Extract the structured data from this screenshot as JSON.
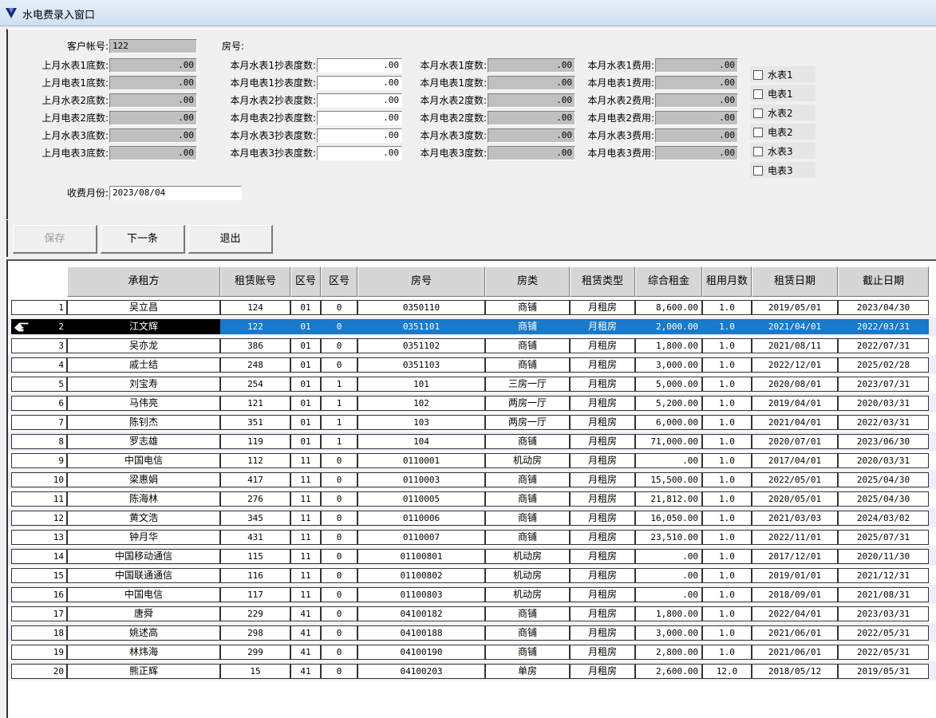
{
  "window": {
    "title": "水电费录入窗口"
  },
  "form": {
    "account_label": "客户帐号:",
    "account_value": "122",
    "room_label": "房号:",
    "room_value": "",
    "month_label": "收费月份:",
    "month_value": "2023/08/04",
    "meter_rows": [
      {
        "prev_label": "上月水表1底数:",
        "prev_value": ".00",
        "reading_label": "本月水表1抄表度数:",
        "reading_value": ".00",
        "usage_label": "本月水表1度数:",
        "usage_value": ".00",
        "fee_label": "本月水表1费用:",
        "fee_value": ".00",
        "check_label": "水表1",
        "checked": false
      },
      {
        "prev_label": "上月电表1底数:",
        "prev_value": ".00",
        "reading_label": "本月电表1抄表度数:",
        "reading_value": ".00",
        "usage_label": "本月电表1度数:",
        "usage_value": ".00",
        "fee_label": "本月电表1费用:",
        "fee_value": ".00",
        "check_label": "电表1",
        "checked": false
      },
      {
        "prev_label": "上月水表2底数:",
        "prev_value": ".00",
        "reading_label": "本月水表2抄表度数:",
        "reading_value": ".00",
        "usage_label": "本月水表2度数:",
        "usage_value": ".00",
        "fee_label": "本月水表2费用:",
        "fee_value": ".00",
        "check_label": "水表2",
        "checked": false
      },
      {
        "prev_label": "上月电表2底数:",
        "prev_value": ".00",
        "reading_label": "本月电表2抄表度数:",
        "reading_value": ".00",
        "usage_label": "本月电表2度数:",
        "usage_value": ".00",
        "fee_label": "本月电表2费用:",
        "fee_value": ".00",
        "check_label": "电表2",
        "checked": false
      },
      {
        "prev_label": "上月水表3底数:",
        "prev_value": ".00",
        "reading_label": "本月水表3抄表度数:",
        "reading_value": ".00",
        "usage_label": "本月水表3度数:",
        "usage_value": ".00",
        "fee_label": "本月水表3费用:",
        "fee_value": ".00",
        "check_label": "水表3",
        "checked": false
      },
      {
        "prev_label": "上月电表3底数:",
        "prev_value": ".00",
        "reading_label": "本月电表3抄表度数:",
        "reading_value": ".00",
        "usage_label": "本月电表3度数:",
        "usage_value": ".00",
        "fee_label": "本月电表3费用:",
        "fee_value": ".00",
        "check_label": "电表3",
        "checked": false
      }
    ]
  },
  "toolbar": {
    "save_label": "保存",
    "next_label": "下一条",
    "exit_label": "退出"
  },
  "grid": {
    "headers": [
      "承租方",
      "租赁账号",
      "区号",
      "区号",
      "房号",
      "房类",
      "租赁类型",
      "综合租金",
      "租用月数",
      "租赁日期",
      "截止日期"
    ],
    "selected_index": 1,
    "rows": [
      {
        "no": "1",
        "tenant": "吴立昌",
        "acct": "124",
        "zone1": "01",
        "zone2": "0",
        "room": "0350110",
        "type": "商铺",
        "lease": "月租房",
        "rent": "8,600.00",
        "months": "1.0",
        "start": "2019/05/01",
        "end": "2023/04/30"
      },
      {
        "no": "2",
        "tenant": "江文辉",
        "acct": "122",
        "zone1": "01",
        "zone2": "0",
        "room": "0351101",
        "type": "商铺",
        "lease": "月租房",
        "rent": "2,000.00",
        "months": "1.0",
        "start": "2021/04/01",
        "end": "2022/03/31"
      },
      {
        "no": "3",
        "tenant": "吴亦龙",
        "acct": "386",
        "zone1": "01",
        "zone2": "0",
        "room": "0351102",
        "type": "商铺",
        "lease": "月租房",
        "rent": "1,800.00",
        "months": "1.0",
        "start": "2021/08/11",
        "end": "2022/07/31"
      },
      {
        "no": "4",
        "tenant": "戚士结",
        "acct": "248",
        "zone1": "01",
        "zone2": "0",
        "room": "0351103",
        "type": "商铺",
        "lease": "月租房",
        "rent": "3,000.00",
        "months": "1.0",
        "start": "2022/12/01",
        "end": "2025/02/28"
      },
      {
        "no": "5",
        "tenant": "刘宝寿",
        "acct": "254",
        "zone1": "01",
        "zone2": "1",
        "room": "101",
        "type": "三房一厅",
        "lease": "月租房",
        "rent": "5,000.00",
        "months": "1.0",
        "start": "2020/08/01",
        "end": "2023/07/31"
      },
      {
        "no": "6",
        "tenant": "马伟亮",
        "acct": "121",
        "zone1": "01",
        "zone2": "1",
        "room": "102",
        "type": "两房一厅",
        "lease": "月租房",
        "rent": "5,200.00",
        "months": "1.0",
        "start": "2019/04/01",
        "end": "2020/03/31"
      },
      {
        "no": "7",
        "tenant": "陈钊杰",
        "acct": "351",
        "zone1": "01",
        "zone2": "1",
        "room": "103",
        "type": "两房一厅",
        "lease": "月租房",
        "rent": "6,000.00",
        "months": "1.0",
        "start": "2021/04/01",
        "end": "2022/03/31"
      },
      {
        "no": "8",
        "tenant": "罗志雄",
        "acct": "119",
        "zone1": "01",
        "zone2": "1",
        "room": "104",
        "type": "商铺",
        "lease": "月租房",
        "rent": "71,000.00",
        "months": "1.0",
        "start": "2020/07/01",
        "end": "2023/06/30"
      },
      {
        "no": "9",
        "tenant": "中国电信",
        "acct": "112",
        "zone1": "11",
        "zone2": "0",
        "room": "0110001",
        "type": "机动房",
        "lease": "月租房",
        "rent": ".00",
        "months": "1.0",
        "start": "2017/04/01",
        "end": "2020/03/31"
      },
      {
        "no": "10",
        "tenant": "梁惠娟",
        "acct": "417",
        "zone1": "11",
        "zone2": "0",
        "room": "0110003",
        "type": "商铺",
        "lease": "月租房",
        "rent": "15,500.00",
        "months": "1.0",
        "start": "2022/05/01",
        "end": "2025/04/30"
      },
      {
        "no": "11",
        "tenant": "陈海林",
        "acct": "276",
        "zone1": "11",
        "zone2": "0",
        "room": "0110005",
        "type": "商铺",
        "lease": "月租房",
        "rent": "21,812.00",
        "months": "1.0",
        "start": "2020/05/01",
        "end": "2025/04/30"
      },
      {
        "no": "12",
        "tenant": "黄文浩",
        "acct": "345",
        "zone1": "11",
        "zone2": "0",
        "room": "0110006",
        "type": "商铺",
        "lease": "月租房",
        "rent": "16,050.00",
        "months": "1.0",
        "start": "2021/03/03",
        "end": "2024/03/02"
      },
      {
        "no": "13",
        "tenant": "钟月华",
        "acct": "431",
        "zone1": "11",
        "zone2": "0",
        "room": "0110007",
        "type": "商铺",
        "lease": "月租房",
        "rent": "23,510.00",
        "months": "1.0",
        "start": "2022/11/01",
        "end": "2025/07/31"
      },
      {
        "no": "14",
        "tenant": "中国移动通信",
        "acct": "115",
        "zone1": "11",
        "zone2": "0",
        "room": "01100801",
        "type": "机动房",
        "lease": "月租房",
        "rent": ".00",
        "months": "1.0",
        "start": "2017/12/01",
        "end": "2020/11/30"
      },
      {
        "no": "15",
        "tenant": "中国联通通信",
        "acct": "116",
        "zone1": "11",
        "zone2": "0",
        "room": "01100802",
        "type": "机动房",
        "lease": "月租房",
        "rent": ".00",
        "months": "1.0",
        "start": "2019/01/01",
        "end": "2021/12/31"
      },
      {
        "no": "16",
        "tenant": "中国电信",
        "acct": "117",
        "zone1": "11",
        "zone2": "0",
        "room": "01100803",
        "type": "机动房",
        "lease": "月租房",
        "rent": ".00",
        "months": "1.0",
        "start": "2018/09/01",
        "end": "2021/08/31"
      },
      {
        "no": "17",
        "tenant": "唐舜",
        "acct": "229",
        "zone1": "41",
        "zone2": "0",
        "room": "04100182",
        "type": "商铺",
        "lease": "月租房",
        "rent": "1,800.00",
        "months": "1.0",
        "start": "2022/04/01",
        "end": "2023/03/31"
      },
      {
        "no": "18",
        "tenant": "姚述高",
        "acct": "298",
        "zone1": "41",
        "zone2": "0",
        "room": "04100188",
        "type": "商铺",
        "lease": "月租房",
        "rent": "3,000.00",
        "months": "1.0",
        "start": "2021/06/01",
        "end": "2022/05/31"
      },
      {
        "no": "19",
        "tenant": "林炜海",
        "acct": "299",
        "zone1": "41",
        "zone2": "0",
        "room": "04100190",
        "type": "商铺",
        "lease": "月租房",
        "rent": "2,800.00",
        "months": "1.0",
        "start": "2021/06/01",
        "end": "2022/05/31"
      },
      {
        "no": "20",
        "tenant": "熊正辉",
        "acct": "15",
        "zone1": "41",
        "zone2": "0",
        "room": "04100203",
        "type": "单房",
        "lease": "月租房",
        "rent": "2,600.00",
        "months": "12.0",
        "start": "2018/05/12",
        "end": "2019/05/31"
      }
    ]
  }
}
